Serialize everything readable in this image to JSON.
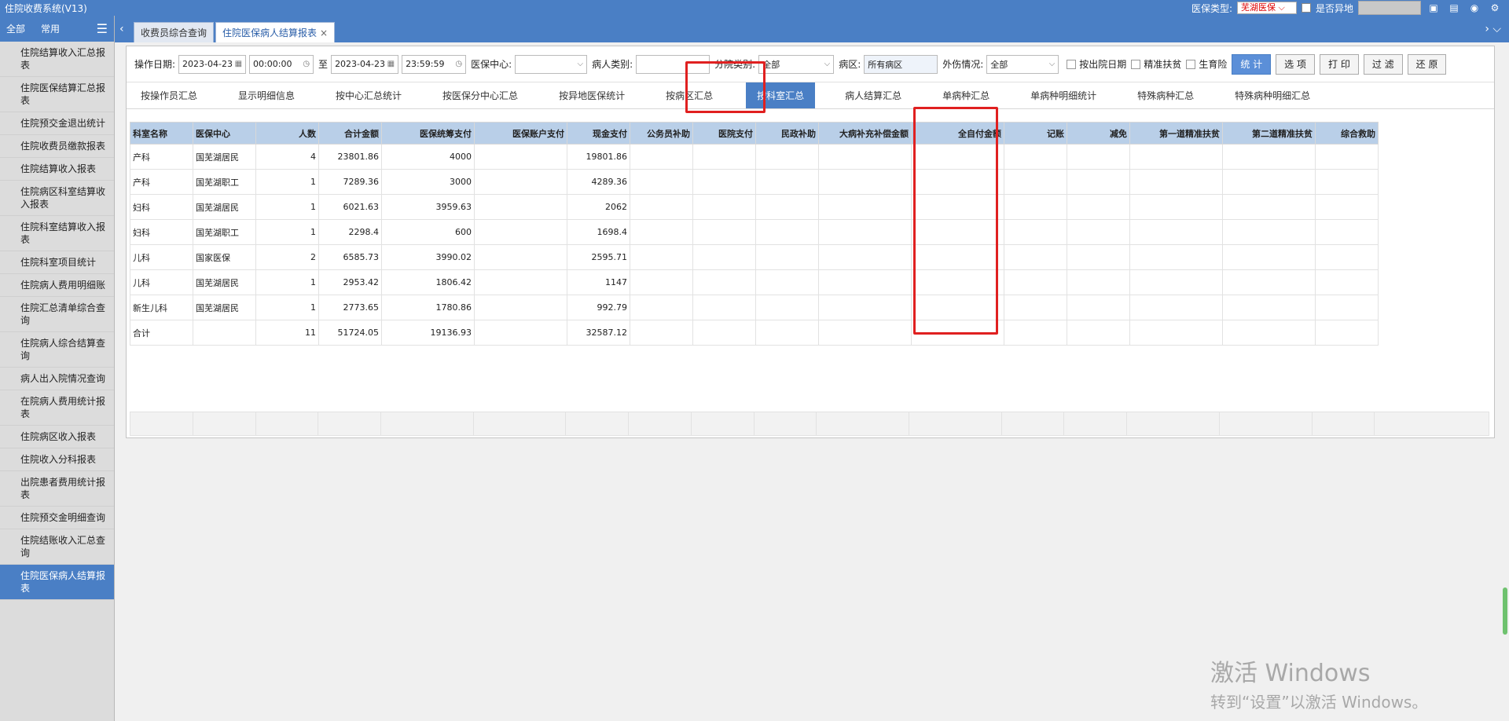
{
  "app": {
    "title": "住院收费系统(V13)"
  },
  "topbar": {
    "insurance_type_label": "医保类型:",
    "insurance_type_value": "芜湖医保",
    "offsite_label": "是否异地"
  },
  "sidebar": {
    "tabs": [
      "全部",
      "常用"
    ],
    "items": [
      "住院结算收入汇总报表",
      "住院医保结算汇总报表",
      "住院预交金退出统计",
      "住院收费员缴款报表",
      "住院结算收入报表",
      "住院病区科室结算收入报表",
      "住院科室结算收入报表",
      "住院科室项目统计",
      "住院病人费用明细账",
      "住院汇总清单综合查询",
      "住院病人综合结算查询",
      "病人出入院情况查询",
      "在院病人费用统计报表",
      "住院病区收入报表",
      "住院收入分科报表",
      "出院患者费用统计报表",
      "住院预交金明细查询",
      "住院结账收入汇总查询",
      "住院医保病人结算报表"
    ],
    "active_index": 18
  },
  "tabs": [
    {
      "label": "收费员综合查询"
    },
    {
      "label": "住院医保病人结算报表"
    }
  ],
  "filters": {
    "op_date_label": "操作日期:",
    "date_from": "2023-04-23",
    "time_from": "00:00:00",
    "to_label": "至",
    "date_to": "2023-04-23",
    "time_to": "23:59:59",
    "center_label": "医保中心:",
    "center_value": "",
    "patient_type_label": "病人类别:",
    "patient_type_value": "",
    "category_label": "分院类别:",
    "category_value": "全部",
    "ward_label": "病区:",
    "ward_value": "所有病区",
    "injury_label": "外伤情况:",
    "injury_value": "全部",
    "chk_discharge": "按出院日期",
    "chk_poverty": "精准扶贫",
    "chk_maternity": "生育险",
    "btn_stats": "统 计",
    "btn_options": "选 项",
    "btn_print": "打 印",
    "btn_filter": "过 滤",
    "btn_restore": "还 原"
  },
  "subtabs": [
    "按操作员汇总",
    "显示明细信息",
    "按中心汇总统计",
    "按医保分中心汇总",
    "按异地医保统计",
    "按病区汇总",
    "按科室汇总",
    "病人结算汇总",
    "单病种汇总",
    "单病种明细统计",
    "特殊病种汇总",
    "特殊病种明细汇总"
  ],
  "active_subtab": 6,
  "table": {
    "columns": [
      "科室名称",
      "医保中心",
      "人数",
      "合计金额",
      "医保统筹支付",
      "医保账户支付",
      "现金支付",
      "公务员补助",
      "医院支付",
      "民政补助",
      "大病补充补偿金额",
      "全自付金额",
      "记账",
      "减免",
      "第一道精准扶贫",
      "第二道精准扶贫",
      "综合救助"
    ],
    "rows": [
      [
        "产科",
        "国芜湖居民",
        "4",
        "23801.86",
        "4000",
        "",
        "19801.86",
        "",
        "",
        "",
        "",
        "",
        "",
        "",
        "",
        "",
        ""
      ],
      [
        "产科",
        "国芜湖职工",
        "1",
        "7289.36",
        "3000",
        "",
        "4289.36",
        "",
        "",
        "",
        "",
        "",
        "",
        "",
        "",
        "",
        ""
      ],
      [
        "妇科",
        "国芜湖居民",
        "1",
        "6021.63",
        "3959.63",
        "",
        "2062",
        "",
        "",
        "",
        "",
        "",
        "",
        "",
        "",
        "",
        ""
      ],
      [
        "妇科",
        "国芜湖职工",
        "1",
        "2298.4",
        "600",
        "",
        "1698.4",
        "",
        "",
        "",
        "",
        "",
        "",
        "",
        "",
        "",
        ""
      ],
      [
        "儿科",
        "国家医保",
        "2",
        "6585.73",
        "3990.02",
        "",
        "2595.71",
        "",
        "",
        "",
        "",
        "",
        "",
        "",
        "",
        "",
        ""
      ],
      [
        "儿科",
        "国芜湖居民",
        "1",
        "2953.42",
        "1806.42",
        "",
        "1147",
        "",
        "",
        "",
        "",
        "",
        "",
        "",
        "",
        "",
        ""
      ],
      [
        "新生儿科",
        "国芜湖居民",
        "1",
        "2773.65",
        "1780.86",
        "",
        "992.79",
        "",
        "",
        "",
        "",
        "",
        "",
        "",
        "",
        "",
        ""
      ],
      [
        "合计",
        "",
        "11",
        "51724.05",
        "19136.93",
        "",
        "32587.12",
        "",
        "",
        "",
        "",
        "",
        "",
        "",
        "",
        "",
        ""
      ]
    ]
  },
  "watermark": {
    "line1": "激活 Windows",
    "line2": "转到“设置”以激活 Windows。"
  }
}
